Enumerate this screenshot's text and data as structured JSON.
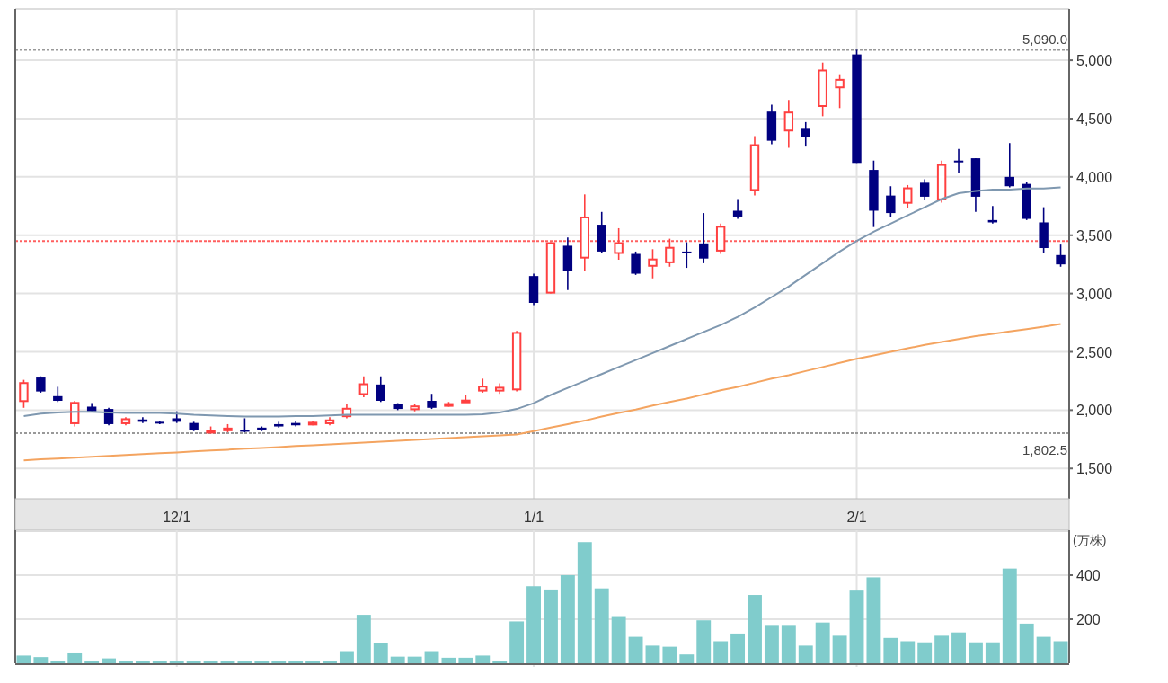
{
  "price_chart": {
    "chart_data": {
      "type": "candlestick",
      "categories": [
        null,
        null,
        null,
        null,
        null,
        null,
        null,
        null,
        null,
        "12/1",
        null,
        null,
        null,
        null,
        null,
        null,
        null,
        null,
        null,
        null,
        null,
        null,
        null,
        null,
        null,
        null,
        null,
        null,
        null,
        null,
        "1/1",
        null,
        null,
        null,
        null,
        null,
        null,
        null,
        null,
        null,
        null,
        null,
        null,
        null,
        null,
        null,
        null,
        null,
        null,
        "2/1",
        null,
        null,
        null,
        null,
        null,
        null,
        null,
        null,
        null,
        null,
        null,
        null
      ],
      "ylim": [
        1240,
        5440
      ],
      "grid": true,
      "yticks": [
        {
          "value": 1500,
          "label": "1,500"
        },
        {
          "value": 2000,
          "label": "2,000"
        },
        {
          "value": 2500,
          "label": "2,500"
        },
        {
          "value": 3000,
          "label": "3,000"
        },
        {
          "value": 3500,
          "label": "3,500"
        },
        {
          "value": 4000,
          "label": "4,000"
        },
        {
          "value": 4500,
          "label": "4,500"
        },
        {
          "value": 5000,
          "label": "5,000"
        }
      ],
      "ohlc": [
        [
          2070,
          2260,
          2020,
          2240
        ],
        [
          2280,
          2290,
          2150,
          2160
        ],
        [
          2120,
          2200,
          2070,
          2080
        ],
        [
          1880,
          2080,
          1860,
          2070
        ],
        [
          2030,
          2060,
          1980,
          1990
        ],
        [
          2010,
          2020,
          1870,
          1880
        ],
        [
          1880,
          1940,
          1870,
          1930
        ],
        [
          1920,
          1940,
          1890,
          1900
        ],
        [
          1900,
          1910,
          1880,
          1890
        ],
        [
          1930,
          1990,
          1890,
          1900
        ],
        [
          1890,
          1900,
          1820,
          1830
        ],
        [
          1810,
          1860,
          1800,
          1830
        ],
        [
          1820,
          1880,
          1810,
          1850
        ],
        [
          1830,
          1930,
          1810,
          1820
        ],
        [
          1850,
          1860,
          1820,
          1830
        ],
        [
          1880,
          1900,
          1850,
          1860
        ],
        [
          1890,
          1910,
          1860,
          1870
        ],
        [
          1880,
          1910,
          1870,
          1900
        ],
        [
          1880,
          1940,
          1870,
          1920
        ],
        [
          1940,
          2050,
          1930,
          2020
        ],
        [
          2130,
          2290,
          2110,
          2230
        ],
        [
          2220,
          2290,
          2070,
          2080
        ],
        [
          2050,
          2060,
          2000,
          2010
        ],
        [
          2000,
          2050,
          1990,
          2040
        ],
        [
          2080,
          2140,
          2010,
          2020
        ],
        [
          2040,
          2070,
          2030,
          2060
        ],
        [
          2080,
          2130,
          2075,
          2090
        ],
        [
          2160,
          2270,
          2150,
          2210
        ],
        [
          2160,
          2230,
          2140,
          2200
        ],
        [
          2170,
          2680,
          2160,
          2670
        ],
        [
          3150,
          3170,
          2900,
          2920
        ],
        [
          3000,
          3440,
          3000,
          3440
        ],
        [
          3410,
          3480,
          3030,
          3190
        ],
        [
          3300,
          3850,
          3190,
          3660
        ],
        [
          3590,
          3700,
          3350,
          3360
        ],
        [
          3340,
          3560,
          3290,
          3440
        ],
        [
          3340,
          3360,
          3160,
          3170
        ],
        [
          3230,
          3380,
          3130,
          3300
        ],
        [
          3260,
          3470,
          3230,
          3400
        ],
        [
          3360,
          3440,
          3220,
          3350
        ],
        [
          3430,
          3690,
          3260,
          3300
        ],
        [
          3360,
          3600,
          3340,
          3580
        ],
        [
          3710,
          3810,
          3640,
          3660
        ],
        [
          3880,
          4350,
          3840,
          4280
        ],
        [
          4560,
          4620,
          4280,
          4310
        ],
        [
          4390,
          4660,
          4250,
          4560
        ],
        [
          4420,
          4470,
          4260,
          4340
        ],
        [
          4600,
          4980,
          4520,
          4920
        ],
        [
          4760,
          4880,
          4590,
          4840
        ],
        [
          5050,
          5090,
          4120,
          4120
        ],
        [
          4060,
          4140,
          3570,
          3710
        ],
        [
          3840,
          3920,
          3660,
          3690
        ],
        [
          3770,
          3930,
          3730,
          3910
        ],
        [
          3950,
          3980,
          3800,
          3830
        ],
        [
          3800,
          4140,
          3780,
          4110
        ],
        [
          4140,
          4240,
          4030,
          4130
        ],
        [
          4160,
          4160,
          3700,
          3830
        ],
        [
          3630,
          3750,
          3600,
          3610
        ],
        [
          4000,
          4290,
          3910,
          3920
        ],
        [
          3940,
          3960,
          3630,
          3640
        ],
        [
          3610,
          3740,
          3350,
          3390
        ],
        [
          3330,
          3420,
          3230,
          3250
        ]
      ],
      "series": [
        {
          "type": "line",
          "color": "#7f98b0",
          "values": [
            1950,
            1970,
            1980,
            1985,
            1985,
            1980,
            1975,
            1975,
            1975,
            1970,
            1960,
            1955,
            1950,
            1945,
            1945,
            1945,
            1950,
            1950,
            1955,
            1960,
            1960,
            1960,
            1960,
            1960,
            1960,
            1960,
            1960,
            1965,
            1980,
            2010,
            2060,
            2130,
            2190,
            2250,
            2310,
            2370,
            2430,
            2490,
            2550,
            2610,
            2670,
            2730,
            2800,
            2880,
            2970,
            3060,
            3160,
            3260,
            3360,
            3450,
            3530,
            3600,
            3670,
            3740,
            3810,
            3860,
            3880,
            3890,
            3890,
            3900,
            3900,
            3910
          ]
        },
        {
          "type": "line",
          "color": "#f4a460",
          "values": [
            1570,
            1578,
            1585,
            1593,
            1600,
            1608,
            1616,
            1623,
            1631,
            1638,
            1646,
            1654,
            1661,
            1669,
            1676,
            1684,
            1692,
            1699,
            1707,
            1714,
            1722,
            1730,
            1737,
            1745,
            1752,
            1760,
            1768,
            1775,
            1783,
            1790,
            1820,
            1850,
            1880,
            1910,
            1945,
            1975,
            2005,
            2040,
            2070,
            2100,
            2135,
            2170,
            2200,
            2235,
            2270,
            2300,
            2335,
            2370,
            2405,
            2440,
            2470,
            2500,
            2530,
            2560,
            2585,
            2610,
            2635,
            2655,
            2675,
            2695,
            2715,
            2740
          ]
        }
      ],
      "ref_lines": [
        {
          "axis": "y",
          "value": 5090,
          "label": "5,090.0",
          "color": "#999999"
        },
        {
          "axis": "y",
          "value": 1802.5,
          "label": "1,802.5",
          "color": "#999999"
        },
        {
          "axis": "y",
          "value": 3450,
          "color": "#ff6060"
        }
      ]
    }
  },
  "volume_chart": {
    "chart_data": {
      "type": "bar",
      "ylabel": "(万株)",
      "ylim": [
        0,
        604
      ],
      "grid": true,
      "yticks": [
        {
          "value": 200,
          "label": "200"
        },
        {
          "value": 400,
          "label": "400"
        }
      ],
      "series": [
        {
          "color": "#80cccc",
          "values": [
            35,
            28,
            8,
            45,
            8,
            22,
            4,
            4,
            4,
            10,
            4,
            5,
            4,
            4,
            4,
            4,
            8,
            4,
            8,
            55,
            220,
            90,
            30,
            30,
            55,
            25,
            25,
            35,
            8,
            190,
            350,
            335,
            400,
            550,
            340,
            210,
            120,
            80,
            75,
            40,
            195,
            100,
            135,
            310,
            170,
            170,
            80,
            185,
            125,
            330,
            390,
            115,
            100,
            95,
            125,
            140,
            95,
            95,
            430,
            180,
            120,
            100
          ]
        }
      ]
    }
  }
}
